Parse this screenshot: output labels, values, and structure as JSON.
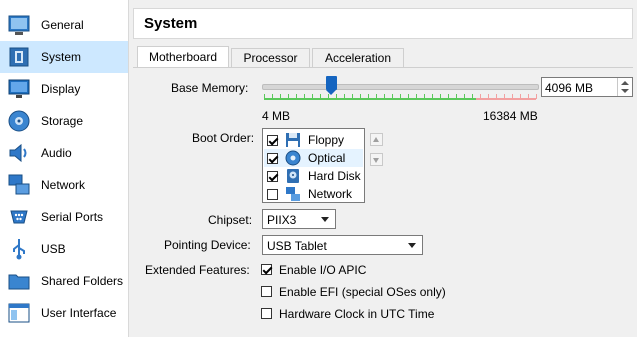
{
  "sidebar": {
    "items": [
      {
        "label": "General",
        "icon": "general-icon"
      },
      {
        "label": "System",
        "icon": "system-icon",
        "selected": true
      },
      {
        "label": "Display",
        "icon": "display-icon"
      },
      {
        "label": "Storage",
        "icon": "storage-icon"
      },
      {
        "label": "Audio",
        "icon": "audio-icon"
      },
      {
        "label": "Network",
        "icon": "network-icon"
      },
      {
        "label": "Serial Ports",
        "icon": "serial-ports-icon"
      },
      {
        "label": "USB",
        "icon": "usb-icon"
      },
      {
        "label": "Shared Folders",
        "icon": "shared-folders-icon"
      },
      {
        "label": "User Interface",
        "icon": "user-interface-icon"
      }
    ]
  },
  "header": {
    "title": "System"
  },
  "tabs": [
    {
      "label": "Motherboard",
      "active": true
    },
    {
      "label": "Processor"
    },
    {
      "label": "Acceleration"
    }
  ],
  "motherboard": {
    "base_memory": {
      "label": "Base Memory:",
      "value": "4096 MB",
      "min_label": "4 MB",
      "max_label": "16384 MB",
      "fraction": 0.25
    },
    "boot_order": {
      "label": "Boot Order:",
      "items": [
        {
          "label": "Floppy",
          "checked": true
        },
        {
          "label": "Optical",
          "checked": true
        },
        {
          "label": "Hard Disk",
          "checked": true
        },
        {
          "label": "Network",
          "checked": false
        }
      ]
    },
    "chipset": {
      "label": "Chipset:",
      "value": "PIIX3"
    },
    "pointing_device": {
      "label": "Pointing Device:",
      "value": "USB Tablet"
    },
    "extended_features": {
      "label": "Extended Features:",
      "items": [
        {
          "label": "Enable I/O APIC",
          "checked": true
        },
        {
          "label": "Enable EFI (special OSes only)",
          "checked": false
        },
        {
          "label": "Hardware Clock in UTC Time",
          "checked": false
        }
      ]
    }
  },
  "colors": {
    "accent": "#1565c0",
    "selection": "#cde8ff",
    "slider_green": "#5ac85a",
    "slider_red": "#f2a0a0"
  }
}
